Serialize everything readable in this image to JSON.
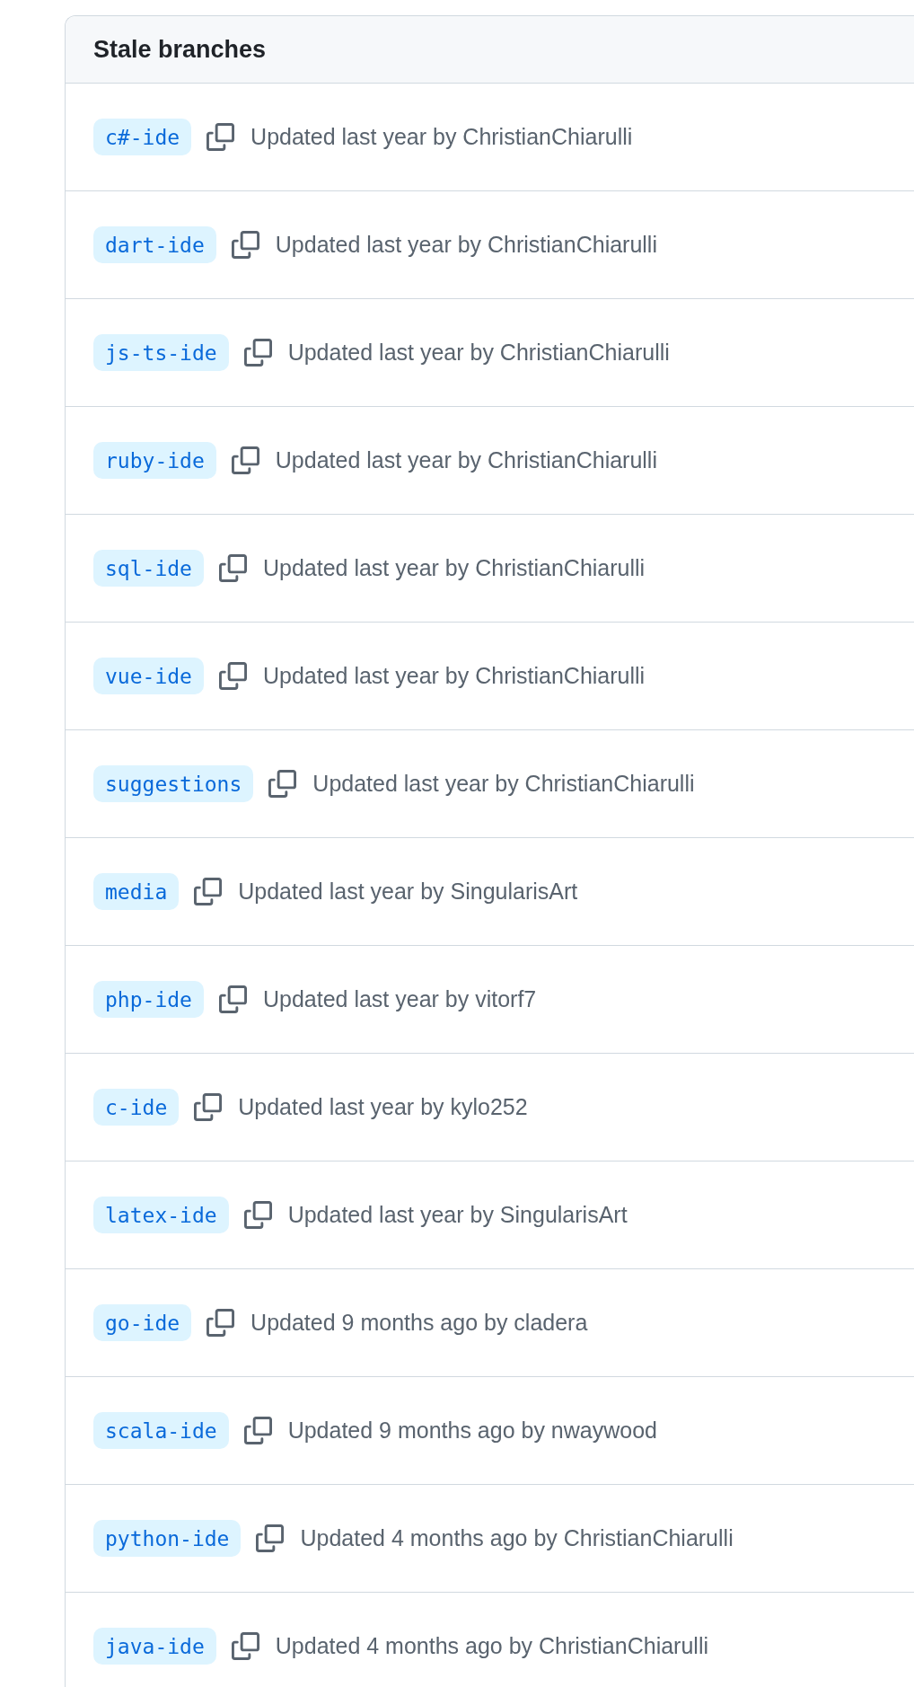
{
  "panel": {
    "title": "Stale branches",
    "branches": [
      {
        "name": "c#-ide",
        "updated": "Updated last year by ChristianChiarulli"
      },
      {
        "name": "dart-ide",
        "updated": "Updated last year by ChristianChiarulli"
      },
      {
        "name": "js-ts-ide",
        "updated": "Updated last year by ChristianChiarulli"
      },
      {
        "name": "ruby-ide",
        "updated": "Updated last year by ChristianChiarulli"
      },
      {
        "name": "sql-ide",
        "updated": "Updated last year by ChristianChiarulli"
      },
      {
        "name": "vue-ide",
        "updated": "Updated last year by ChristianChiarulli"
      },
      {
        "name": "suggestions",
        "updated": "Updated last year by ChristianChiarulli"
      },
      {
        "name": "media",
        "updated": "Updated last year by SingularisArt"
      },
      {
        "name": "php-ide",
        "updated": "Updated last year by vitorf7"
      },
      {
        "name": "c-ide",
        "updated": "Updated last year by kylo252"
      },
      {
        "name": "latex-ide",
        "updated": "Updated last year by SingularisArt"
      },
      {
        "name": "go-ide",
        "updated": "Updated 9 months ago by cladera"
      },
      {
        "name": "scala-ide",
        "updated": "Updated 9 months ago by nwaywood"
      },
      {
        "name": "python-ide",
        "updated": "Updated 4 months ago by ChristianChiarulli"
      },
      {
        "name": "java-ide",
        "updated": "Updated 4 months ago by ChristianChiarulli"
      }
    ]
  }
}
